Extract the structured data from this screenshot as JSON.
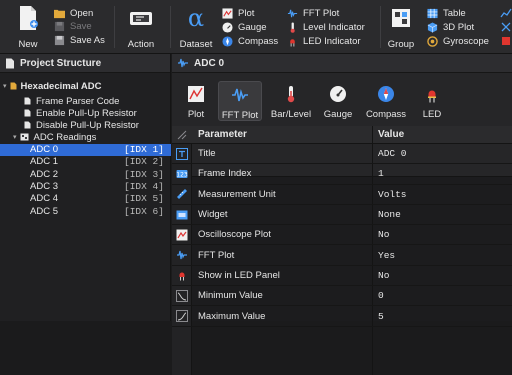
{
  "toolbar": {
    "new": "New",
    "open": "Open",
    "save": "Save",
    "save_as": "Save As",
    "action": "Action",
    "dataset": "Dataset",
    "plot": "Plot",
    "gauge": "Gauge",
    "compass": "Compass",
    "fft_plot": "FFT Plot",
    "level_indicator": "Level Indicator",
    "led_indicator": "LED Indicator",
    "group": "Group",
    "table": "Table",
    "plot_3d": "3D Plot",
    "gyroscope": "Gyroscope"
  },
  "left_panel": {
    "title": "Project Structure",
    "project": "Hexadecimal ADC",
    "items": [
      {
        "label": "Frame Parser Code"
      },
      {
        "label": "Enable Pull-Up Resistor"
      },
      {
        "label": "Disable Pull-Up Resistor"
      }
    ],
    "group": "ADC Readings",
    "datasets": [
      {
        "label": "ADC 0",
        "idx": "[IDX 1]"
      },
      {
        "label": "ADC 1",
        "idx": "[IDX 2]"
      },
      {
        "label": "ADC 2",
        "idx": "[IDX 3]"
      },
      {
        "label": "ADC 3",
        "idx": "[IDX 4]"
      },
      {
        "label": "ADC 4",
        "idx": "[IDX 5]"
      },
      {
        "label": "ADC 5",
        "idx": "[IDX 6]"
      }
    ]
  },
  "right_panel": {
    "title": "ADC 0",
    "widget_tabs": [
      {
        "label": "Plot"
      },
      {
        "label": "FFT Plot"
      },
      {
        "label": "Bar/Level"
      },
      {
        "label": "Gauge"
      },
      {
        "label": "Compass"
      },
      {
        "label": "LED"
      }
    ],
    "columns": {
      "parameter": "Parameter",
      "value": "Value"
    },
    "rows": [
      {
        "parameter": "Title",
        "value": "ADC 0"
      },
      {
        "parameter": "Frame Index",
        "value": "1"
      },
      {
        "parameter": "Measurement Unit",
        "value": "Volts"
      },
      {
        "parameter": "Widget",
        "value": "None"
      },
      {
        "parameter": "Oscilloscope Plot",
        "value": "No"
      },
      {
        "parameter": "FFT Plot",
        "value": "Yes"
      },
      {
        "parameter": "Show in LED Panel",
        "value": "No"
      },
      {
        "parameter": "Minimum Value",
        "value": "0"
      },
      {
        "parameter": "Maximum Value",
        "value": "5"
      }
    ]
  },
  "colors": {
    "selection": "#2f6bd6",
    "accent": "#4a8cf0"
  }
}
